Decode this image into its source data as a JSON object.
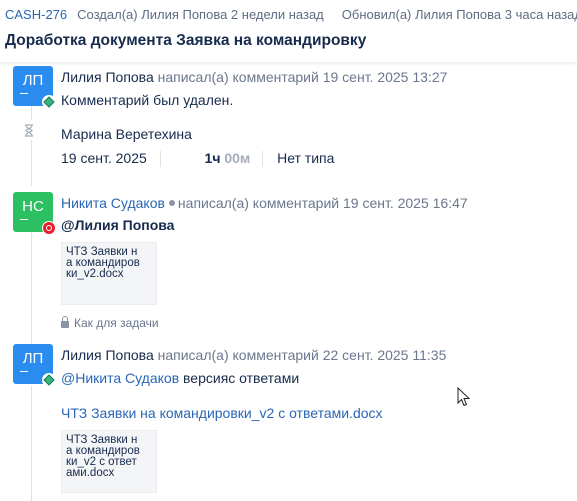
{
  "header": {
    "issue_key": "CASH-276",
    "created": "Создал(а) Лилия Попова 2 недели назад",
    "updated": "Обновил(а) Лилия Попова 3 часа назад",
    "title": "Доработка документа Заявка на командировку"
  },
  "activity": [
    {
      "avatar_initials": "ЛП",
      "author": "Лилия Попова",
      "action": "написал(а) комментарий 19 сент. 2025 13:27",
      "body": "Комментарий был удален."
    },
    {
      "worklog_author": "Марина Веретехина",
      "date": "19 сент. 2025",
      "hours": "1ч",
      "minutes": "00м",
      "type": "Нет типа"
    },
    {
      "avatar_initials": "НС",
      "author": "Никита Судаков",
      "action": "написал(а) комментарий 19 сент. 2025 16:47",
      "mention": "@Лилия Попова",
      "attachment_preview": "ЧТЗ Заявки н\nа командиров\nки_v2.docx",
      "restriction": "Как для задачи"
    },
    {
      "avatar_initials": "ЛП",
      "author": "Лилия Попова",
      "action": "написал(а) комментарий 22 сент. 2025 11:35",
      "mention": "@Никита Судаков",
      "body_rest": "версияс ответами",
      "attachment_link": "ЧТЗ Заявки на командировки_v2 с ответами.docx",
      "attachment_preview": "ЧТЗ Заявки н\nа командиров\nки_v2 с ответ\nами.docx"
    }
  ],
  "colors": {
    "link": "#2a66b5",
    "avatar_blue": "#2b8cef",
    "avatar_green": "#2cc063",
    "muted": "#6b778c"
  }
}
